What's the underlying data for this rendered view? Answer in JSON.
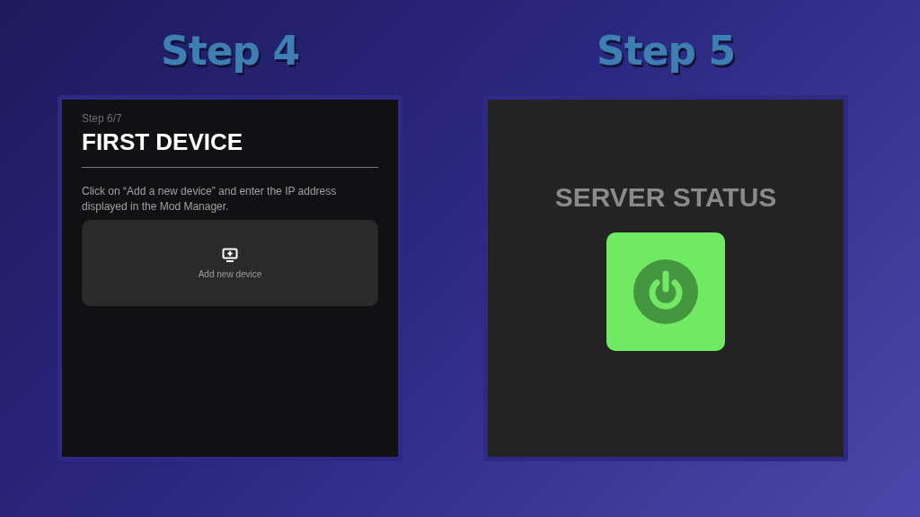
{
  "steps": [
    {
      "heading": "Step 4",
      "kind": "device",
      "screen": {
        "step": "Step 6/7",
        "title": "FIRST DEVICE",
        "instructions": "Click on “Add a new device” and enter the IP address displayed in the Mod Manager.",
        "button": "Add new device"
      }
    },
    {
      "heading": "Step 5",
      "kind": "server",
      "screen": {
        "title": "SERVER STATUS",
        "on": true
      }
    }
  ]
}
